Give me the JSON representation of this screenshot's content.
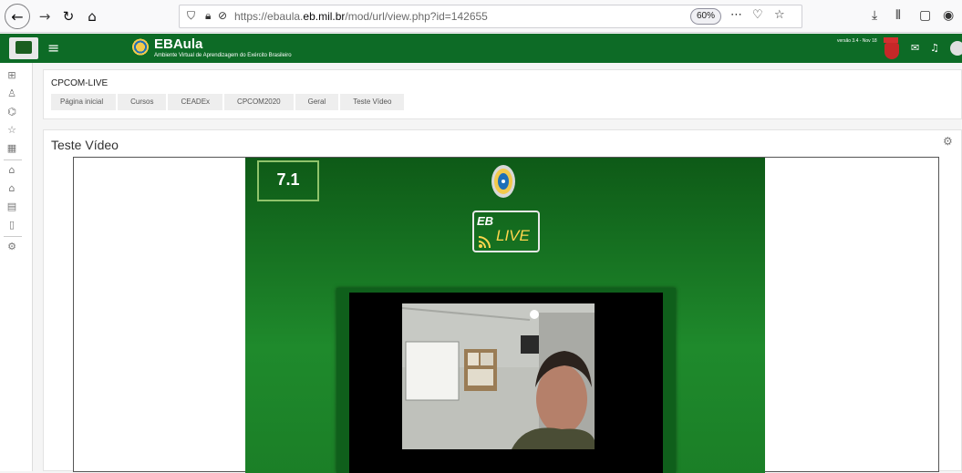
{
  "browser": {
    "url_prefix": "https://ebaula.",
    "url_domain": "eb.mil.br",
    "url_path": "/mod/url/view.php?id=142655",
    "zoom": "60%"
  },
  "navbar": {
    "brand_title": "EBAula",
    "brand_subtitle": "Ambiente Virtual de Aprendizagem do Exército Brasileiro",
    "version": "versão 3.4 - Nov 18"
  },
  "header": {
    "course_name": "CPCOM-LIVE",
    "breadcrumb": [
      "Página inicial",
      "Cursos",
      "CEADEx",
      "CPCOM2020",
      "Geral",
      "Teste Vídeo"
    ]
  },
  "main": {
    "title": "Teste Vídeo",
    "video_badge": "7.1",
    "live_logo_eb": "EB",
    "live_logo_word": "LIVE"
  },
  "colors": {
    "navbar": "#0d6b26",
    "video_green": "#1f8a2c",
    "badge_border": "#8fc36b"
  },
  "icons": {
    "back": "arrow-left-icon",
    "forward": "arrow-right-icon",
    "reload": "reload-icon",
    "home": "home-icon",
    "settings": "gear-icon"
  }
}
